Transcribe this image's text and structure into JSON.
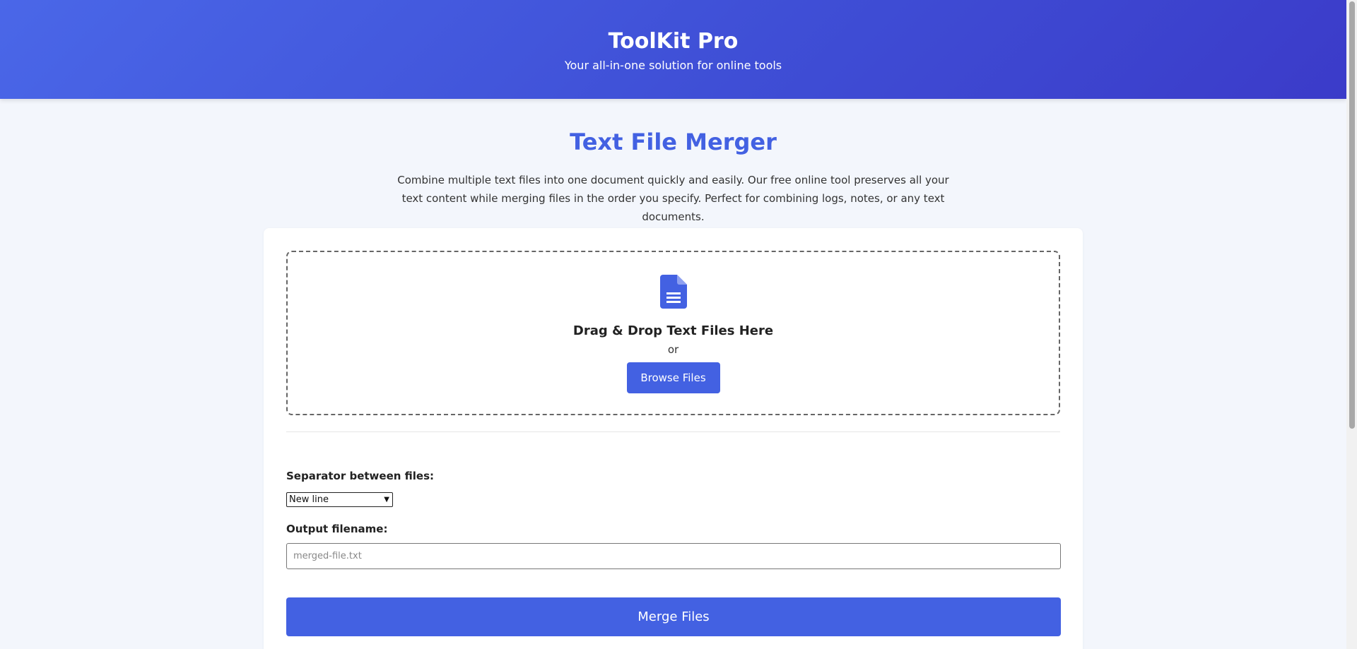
{
  "header": {
    "title": "ToolKit Pro",
    "subtitle": "Your all-in-one solution for online tools"
  },
  "tool": {
    "title": "Text File Merger",
    "description": "Combine multiple text files into one document quickly and easily. Our free online tool preserves all your text content while merging files in the order you specify. Perfect for combining logs, notes, or any text documents."
  },
  "dropzone": {
    "icon": "file-text-icon",
    "heading": "Drag & Drop Text Files Here",
    "or_text": "or",
    "browse_label": "Browse Files"
  },
  "options": {
    "separator_label": "Separator between files:",
    "separator_value": "New line",
    "output_label": "Output filename:",
    "output_placeholder": "merged-file.txt",
    "output_value": ""
  },
  "actions": {
    "merge_label": "Merge Files"
  },
  "colors": {
    "accent": "#4361e2",
    "header_start": "#4a67e8",
    "header_end": "#3b3bc9"
  }
}
